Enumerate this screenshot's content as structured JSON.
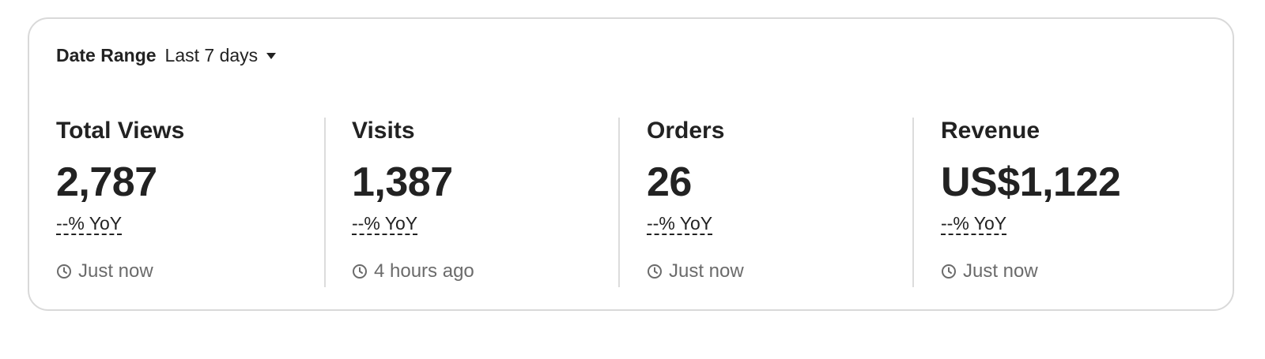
{
  "date_range": {
    "label": "Date Range",
    "value": "Last 7 days"
  },
  "stats": [
    {
      "title": "Total Views",
      "value": "2,787",
      "yoy": "--% YoY",
      "updated": "Just now"
    },
    {
      "title": "Visits",
      "value": "1,387",
      "yoy": "--% YoY",
      "updated": "4 hours ago"
    },
    {
      "title": "Orders",
      "value": "26",
      "yoy": "--% YoY",
      "updated": "Just now"
    },
    {
      "title": "Revenue",
      "value": "US$1,122",
      "yoy": "--% YoY",
      "updated": "Just now"
    }
  ],
  "icons": {
    "caret": "chevron-down-icon",
    "clock": "clock-icon"
  },
  "colors": {
    "text": "#222222",
    "muted": "#6b6b6b",
    "border": "#d9d9d9"
  }
}
